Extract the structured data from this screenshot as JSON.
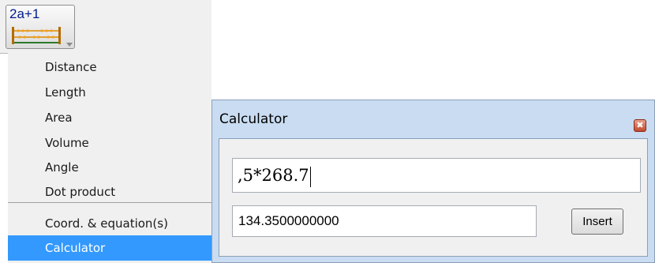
{
  "toolbar": {
    "tool_label": "2a+1",
    "tool_icon": "measurement-ruler-icon",
    "dropdown_icon": "dropdown-arrow-icon"
  },
  "menu": {
    "items": [
      {
        "label": "Distance"
      },
      {
        "label": "Length"
      },
      {
        "label": "Area"
      },
      {
        "label": "Volume"
      },
      {
        "label": "Angle"
      },
      {
        "label": "Dot product"
      },
      {
        "label": "Coord. & equation(s)"
      },
      {
        "label": "Calculator"
      }
    ],
    "selected": "Calculator"
  },
  "calculator": {
    "title": "Calculator",
    "close_icon": "close-icon",
    "expression": ",5*268.7",
    "result": "134.3500000000",
    "insert_label": "Insert"
  },
  "colors": {
    "selection": "#3399ff",
    "dialog_frame": "#c9dcf1",
    "close_button": "#c24a2c",
    "tool_label": "#001a8c"
  }
}
